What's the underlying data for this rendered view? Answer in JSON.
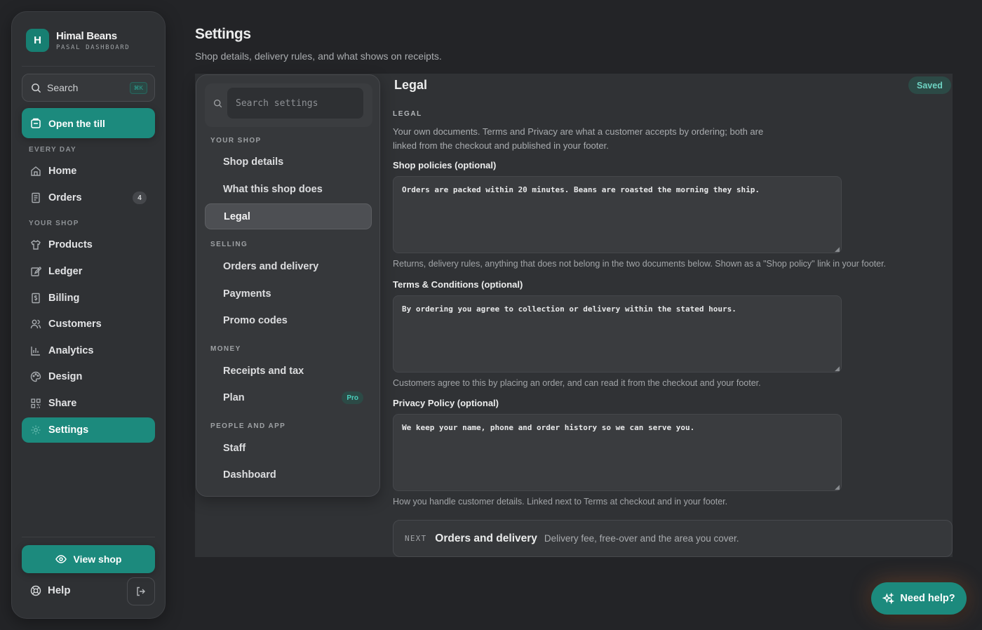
{
  "brand": {
    "logo_letter": "H",
    "name": "Himal Beans",
    "subtitle": "PASAL DASHBOARD"
  },
  "app_search": {
    "label": "Search",
    "shortcut": "⌘K"
  },
  "open_till": {
    "label": "Open the till",
    "icon": "register-icon"
  },
  "nav_groups": [
    {
      "title": "EVERY DAY",
      "items": [
        {
          "label": "Home",
          "icon": "home-icon"
        },
        {
          "label": "Orders",
          "icon": "orders-icon",
          "count": "4"
        }
      ]
    },
    {
      "title": "YOUR SHOP",
      "items": [
        {
          "label": "Products",
          "icon": "shirt-icon"
        },
        {
          "label": "Ledger",
          "icon": "ledger-icon"
        },
        {
          "label": "Billing",
          "icon": "billing-icon"
        },
        {
          "label": "Customers",
          "icon": "users-icon"
        },
        {
          "label": "Analytics",
          "icon": "chart-icon"
        },
        {
          "label": "Design",
          "icon": "palette-icon"
        },
        {
          "label": "Share",
          "icon": "qr-icon"
        },
        {
          "label": "Settings",
          "icon": "gear-icon",
          "active": true
        }
      ]
    }
  ],
  "view_shop": {
    "label": "View shop",
    "icon": "eye-icon"
  },
  "help": {
    "label": "Help",
    "icon": "lifebuoy-icon"
  },
  "logout": {
    "icon": "logout-icon"
  },
  "header": {
    "title": "Settings",
    "subtitle": "Shop details, delivery rules, and what shows on receipts."
  },
  "settings_nav": {
    "search_placeholder": "Search settings",
    "groups": [
      {
        "title": "YOUR SHOP",
        "items": [
          {
            "label": "Shop details"
          },
          {
            "label": "What this shop does"
          },
          {
            "label": "Legal",
            "active": true
          }
        ]
      },
      {
        "title": "SELLING",
        "items": [
          {
            "label": "Orders and delivery"
          },
          {
            "label": "Payments"
          },
          {
            "label": "Promo codes"
          }
        ]
      },
      {
        "title": "MONEY",
        "items": [
          {
            "label": "Receipts and tax"
          },
          {
            "label": "Plan",
            "badge": "Pro"
          }
        ]
      },
      {
        "title": "PEOPLE AND APP",
        "items": [
          {
            "label": "Staff"
          },
          {
            "label": "Dashboard"
          }
        ]
      }
    ]
  },
  "legal": {
    "title": "Legal",
    "status": "Saved",
    "section_label": "LEGAL",
    "intro": "Your own documents. Terms and Privacy are what a customer accepts by ordering; both are linked from the checkout and published in your footer.",
    "fields": [
      {
        "label": "Shop policies (optional)",
        "value": "Orders are packed within 20 minutes. Beans are roasted the morning they ship.",
        "hint": "Returns, delivery rules, anything that does not belong in the two documents below. Shown as a \"Shop policy\" link in your footer."
      },
      {
        "label": "Terms & Conditions (optional)",
        "value": "By ordering you agree to collection or delivery within the stated hours.",
        "hint": "Customers agree to this by placing an order, and can read it from the checkout and your footer."
      },
      {
        "label": "Privacy Policy (optional)",
        "value": "We keep your name, phone and order history so we can serve you.",
        "hint": "How you handle customer details. Linked next to Terms at checkout and in your footer."
      }
    ]
  },
  "next": {
    "tag": "NEXT",
    "title": "Orders and delivery",
    "description": "Delivery fee, free-over and the area you cover."
  },
  "need_help": {
    "label": "Need help?",
    "icon": "sparkle-icon"
  },
  "colors": {
    "accent": "#1c8a7d",
    "background": "#232427",
    "panel": "#303235",
    "badge_text": "#4ad0bd"
  }
}
